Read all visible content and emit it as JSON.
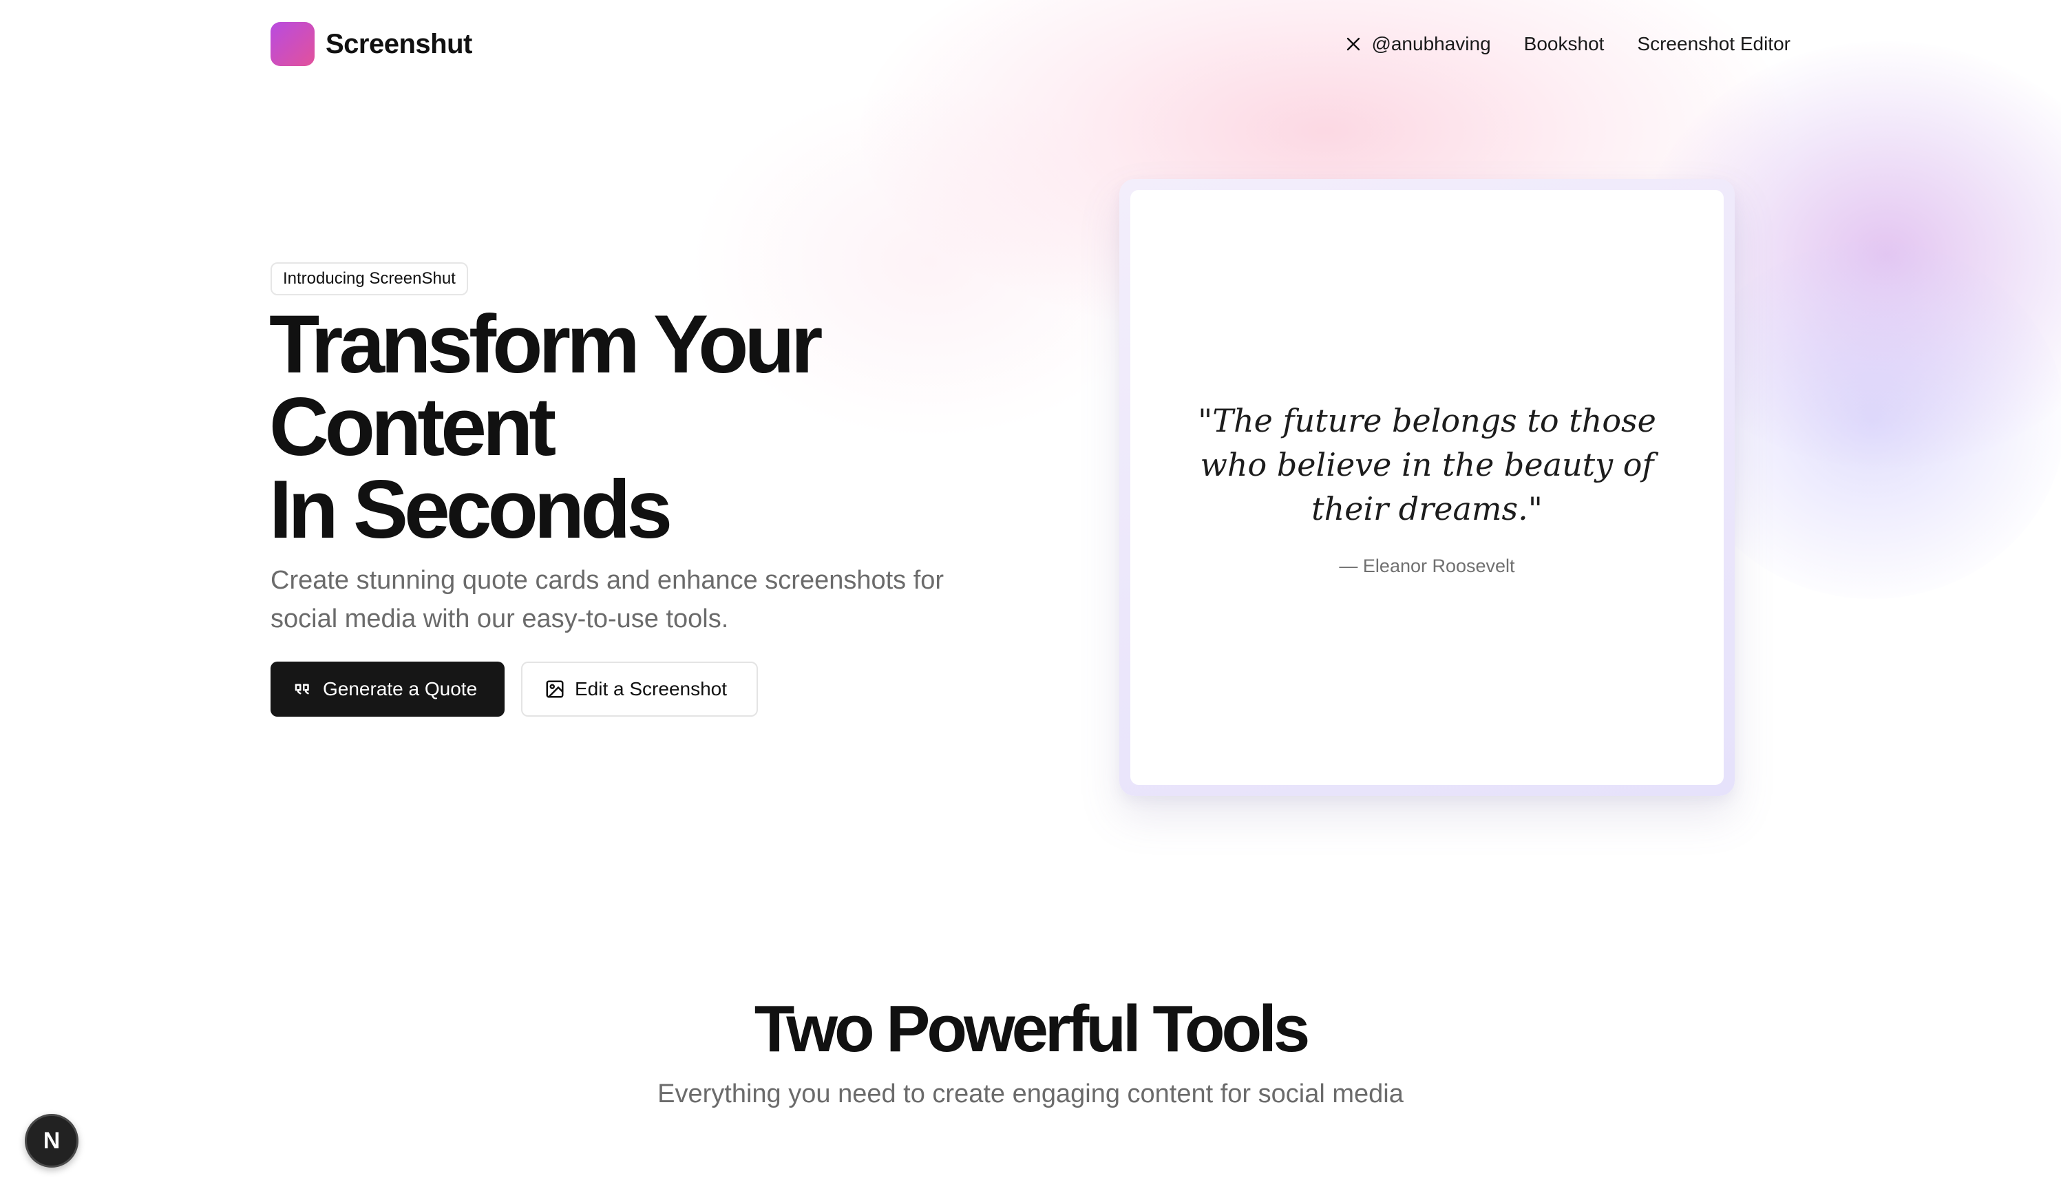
{
  "header": {
    "brand": "Screenshut",
    "nav": [
      {
        "label": "@anubhaving",
        "icon": "x-twitter-icon"
      },
      {
        "label": "Bookshot"
      },
      {
        "label": "Screenshot Editor"
      }
    ]
  },
  "hero": {
    "badge": "Introducing ScreenShut",
    "title_lines": [
      "Transform Your",
      "Content",
      "In Seconds"
    ],
    "subtitle": "Create stunning quote cards and enhance screenshots for social media with our easy-to-use tools.",
    "buttons": {
      "primary": {
        "label": "Generate a Quote",
        "icon": "quote-icon"
      },
      "secondary": {
        "label": "Edit a Screenshot",
        "icon": "image-icon"
      }
    }
  },
  "quote_card": {
    "text": "\"The future belongs to those who believe in the beauty of their dreams.\"",
    "author": "— Eleanor Roosevelt"
  },
  "tools": {
    "title": "Two Powerful Tools",
    "subtitle": "Everything you need to create engaging content for social media"
  },
  "dev_badge": {
    "label": "N"
  },
  "colors": {
    "logo_start": "#b84be0",
    "logo_end": "#e2529b",
    "primary_button": "#161616",
    "muted_text": "#6b6b6b"
  }
}
